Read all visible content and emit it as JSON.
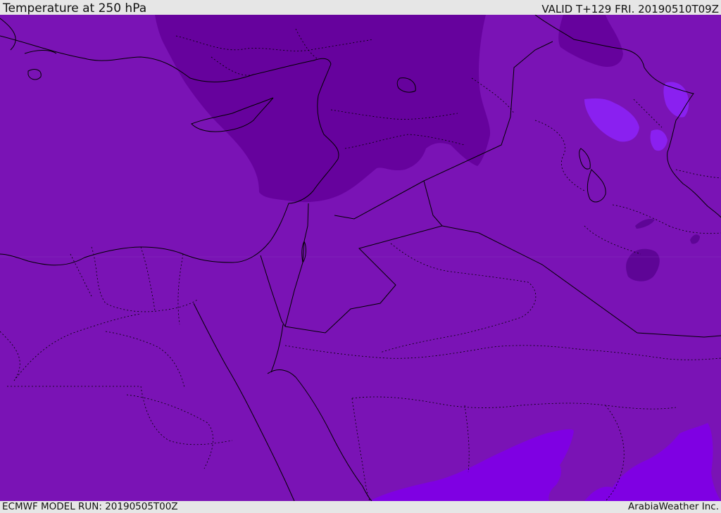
{
  "header": {
    "title": "Temperature at 250 hPa",
    "valid_time": "VALID T+129 FRI. 20190510T09Z"
  },
  "footer": {
    "model_run": "ECMWF MODEL RUN: 20190505T00Z",
    "credit": "ArabiaWeather Inc."
  },
  "map": {
    "variable": "temperature",
    "pressure_level_hpa": 250,
    "colors": {
      "base_fill": "#7a13b5",
      "cold_region": "#66029d",
      "warm_region": "#7f00e3",
      "light_patch": "#8a20f0",
      "dark_patch": "#5e0596",
      "border_line": "#000000"
    }
  }
}
